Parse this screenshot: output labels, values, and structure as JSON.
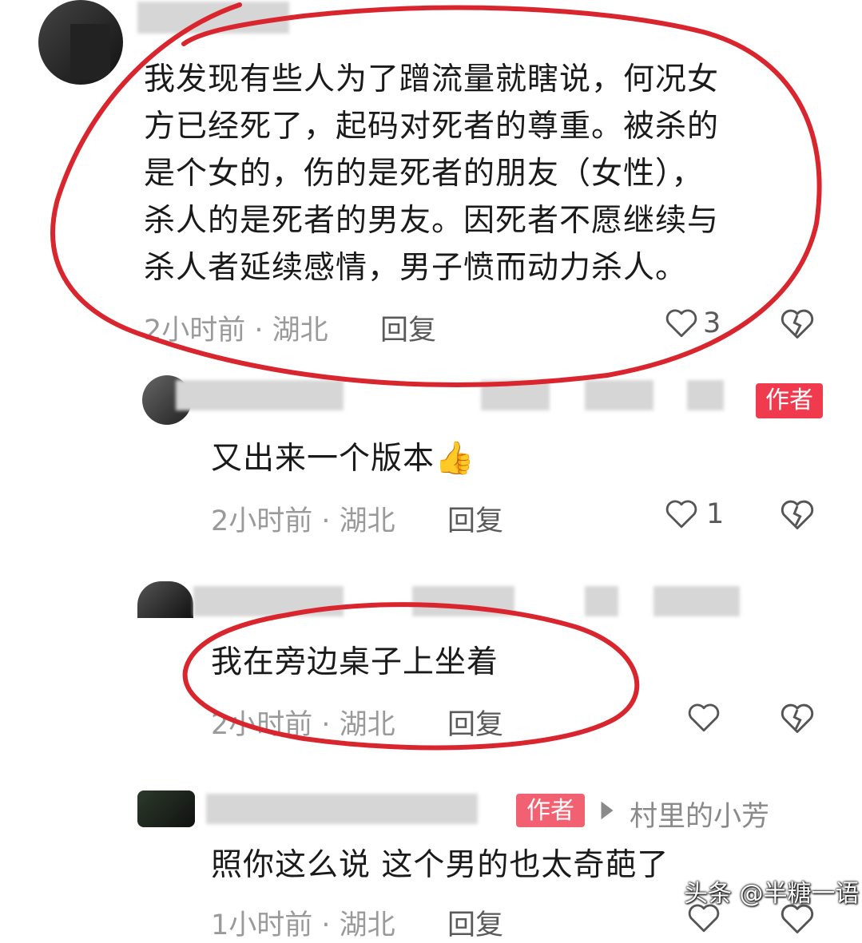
{
  "comments": [
    {
      "text_lines": [
        "我发现有些人为了蹭流量就瞎说，何况女",
        "方已经死了，起码对死者的尊重。被杀的",
        "是个女的，伤的是死者的朋友（女性），",
        "杀人的是死者的男友。因死者不愿继续与",
        "杀人者延续感情，男子愤而动力杀人。"
      ],
      "time_location": "2小时前 · 湖北",
      "reply_label": "回复",
      "likes": "3"
    },
    {
      "badge": "作者",
      "text": "又出来一个版本",
      "emoji": "👍",
      "time_location": "2小时前 · 湖北",
      "reply_label": "回复",
      "likes": "1"
    },
    {
      "text": "我在旁边桌子上坐着",
      "time_location": "2小时前 · 湖北",
      "reply_label": "回复"
    },
    {
      "badge": "作者",
      "reply_to": "村里的小芳",
      "text": "照你这么说 这个男的也太奇葩了",
      "time_location": "1小时前 · 湖北",
      "reply_label": "回复"
    }
  ],
  "watermark": "头条 @半糖一语",
  "colors": {
    "annotation_red": "#d9262e",
    "badge_red": "#f03a4e",
    "meta_gray": "#9a9a9a"
  }
}
